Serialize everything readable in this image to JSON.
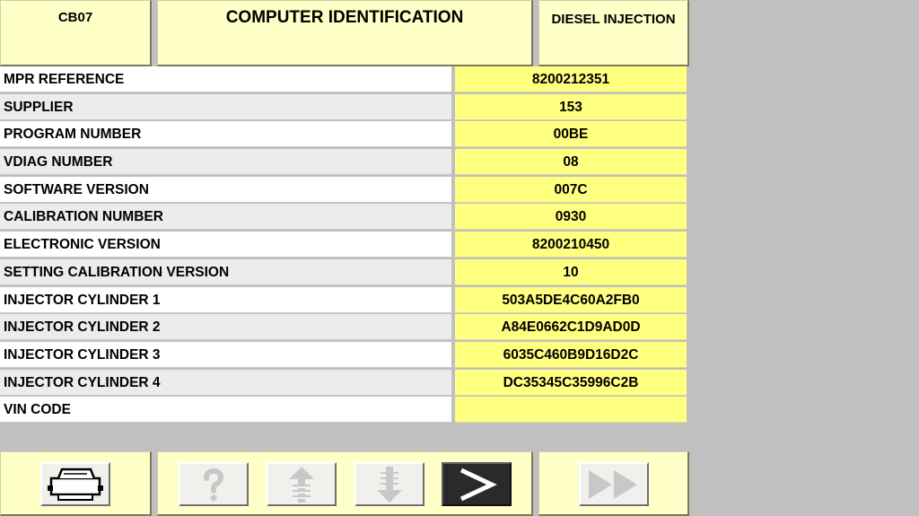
{
  "header": {
    "code": "CB07",
    "title": "COMPUTER IDENTIFICATION",
    "system": "DIESEL INJECTION"
  },
  "rows": [
    {
      "label": "MPR REFERENCE",
      "value": "8200212351"
    },
    {
      "label": "SUPPLIER",
      "value": "153"
    },
    {
      "label": "PROGRAM NUMBER",
      "value": "00BE"
    },
    {
      "label": "VDIAG NUMBER",
      "value": "08"
    },
    {
      "label": "SOFTWARE VERSION",
      "value": "007C"
    },
    {
      "label": "CALIBRATION NUMBER",
      "value": "0930"
    },
    {
      "label": "ELECTRONIC VERSION",
      "value": "8200210450"
    },
    {
      "label": "SETTING CALIBRATION VERSION",
      "value": "10"
    },
    {
      "label": "INJECTOR CYLINDER 1",
      "value": "503A5DE4C60A2FB0"
    },
    {
      "label": "INJECTOR CYLINDER 2",
      "value": "A84E0662C1D9AD0D"
    },
    {
      "label": "INJECTOR CYLINDER 3",
      "value": "6035C460B9D16D2C"
    },
    {
      "label": "INJECTOR CYLINDER 4",
      "value": "DC35345C35996C2B"
    },
    {
      "label": "VIN CODE",
      "value": ""
    }
  ],
  "toolbar": {
    "buttons": [
      {
        "name": "print-button",
        "icon": "printer-icon",
        "enabled": true
      },
      {
        "name": "help-button",
        "icon": "question-mark-icon",
        "enabled": false
      },
      {
        "name": "page-up-button",
        "icon": "arrow-up-icon",
        "enabled": false
      },
      {
        "name": "page-down-button",
        "icon": "arrow-down-icon",
        "enabled": false
      },
      {
        "name": "next-button",
        "icon": "chevron-right-icon",
        "enabled": true
      },
      {
        "name": "fast-forward-button",
        "icon": "fast-forward-icon",
        "enabled": false
      }
    ]
  },
  "colors": {
    "panel": "#ffffc8",
    "value_cell": "#ffff80",
    "label_cell": "#ffffff",
    "label_cell_alt": "#ececec",
    "background": "#c0c0c0"
  }
}
